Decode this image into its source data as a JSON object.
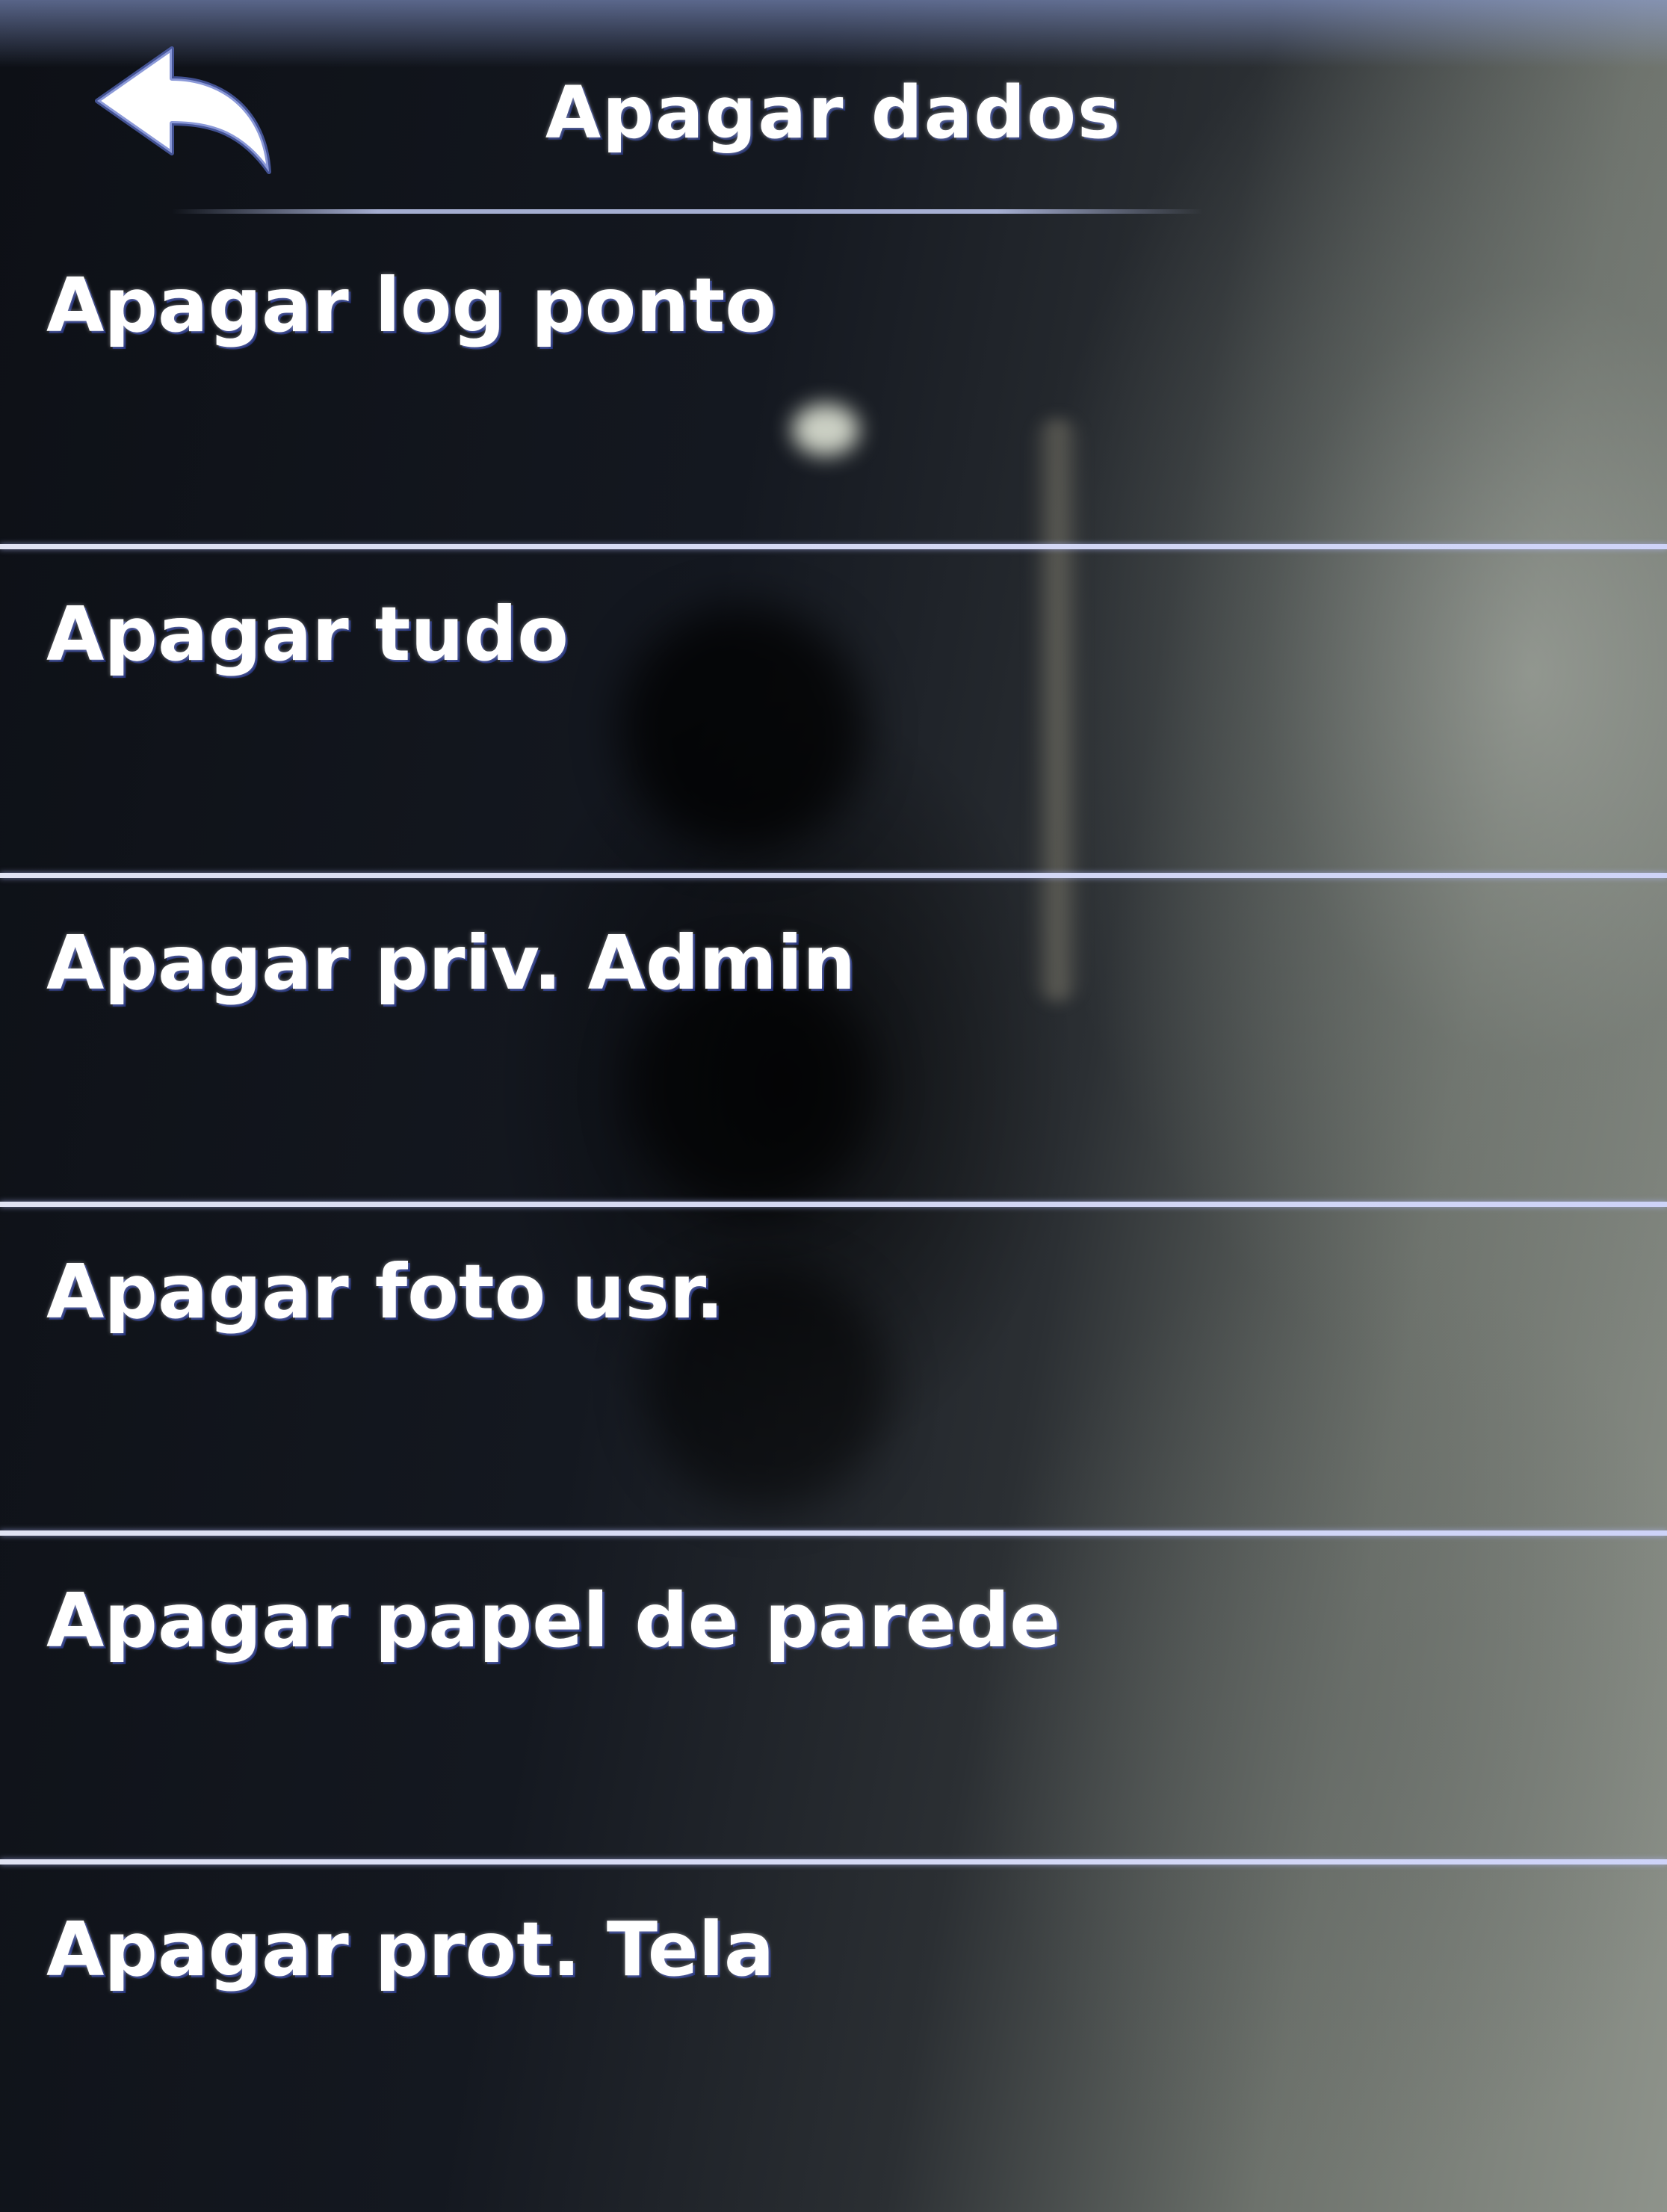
{
  "header": {
    "title": "Apagar dados",
    "back_icon": "back-arrow-icon"
  },
  "menu": {
    "items": [
      {
        "label": "Apagar log ponto"
      },
      {
        "label": "Apagar tudo"
      },
      {
        "label": "Apagar priv. Admin"
      },
      {
        "label": "Apagar foto usr."
      },
      {
        "label": "Apagar papel de parede"
      },
      {
        "label": "Apagar prot. Tela"
      }
    ]
  },
  "colors": {
    "text": "#ffffff",
    "divider": "#e6e9ff",
    "background": "#0d1016"
  }
}
